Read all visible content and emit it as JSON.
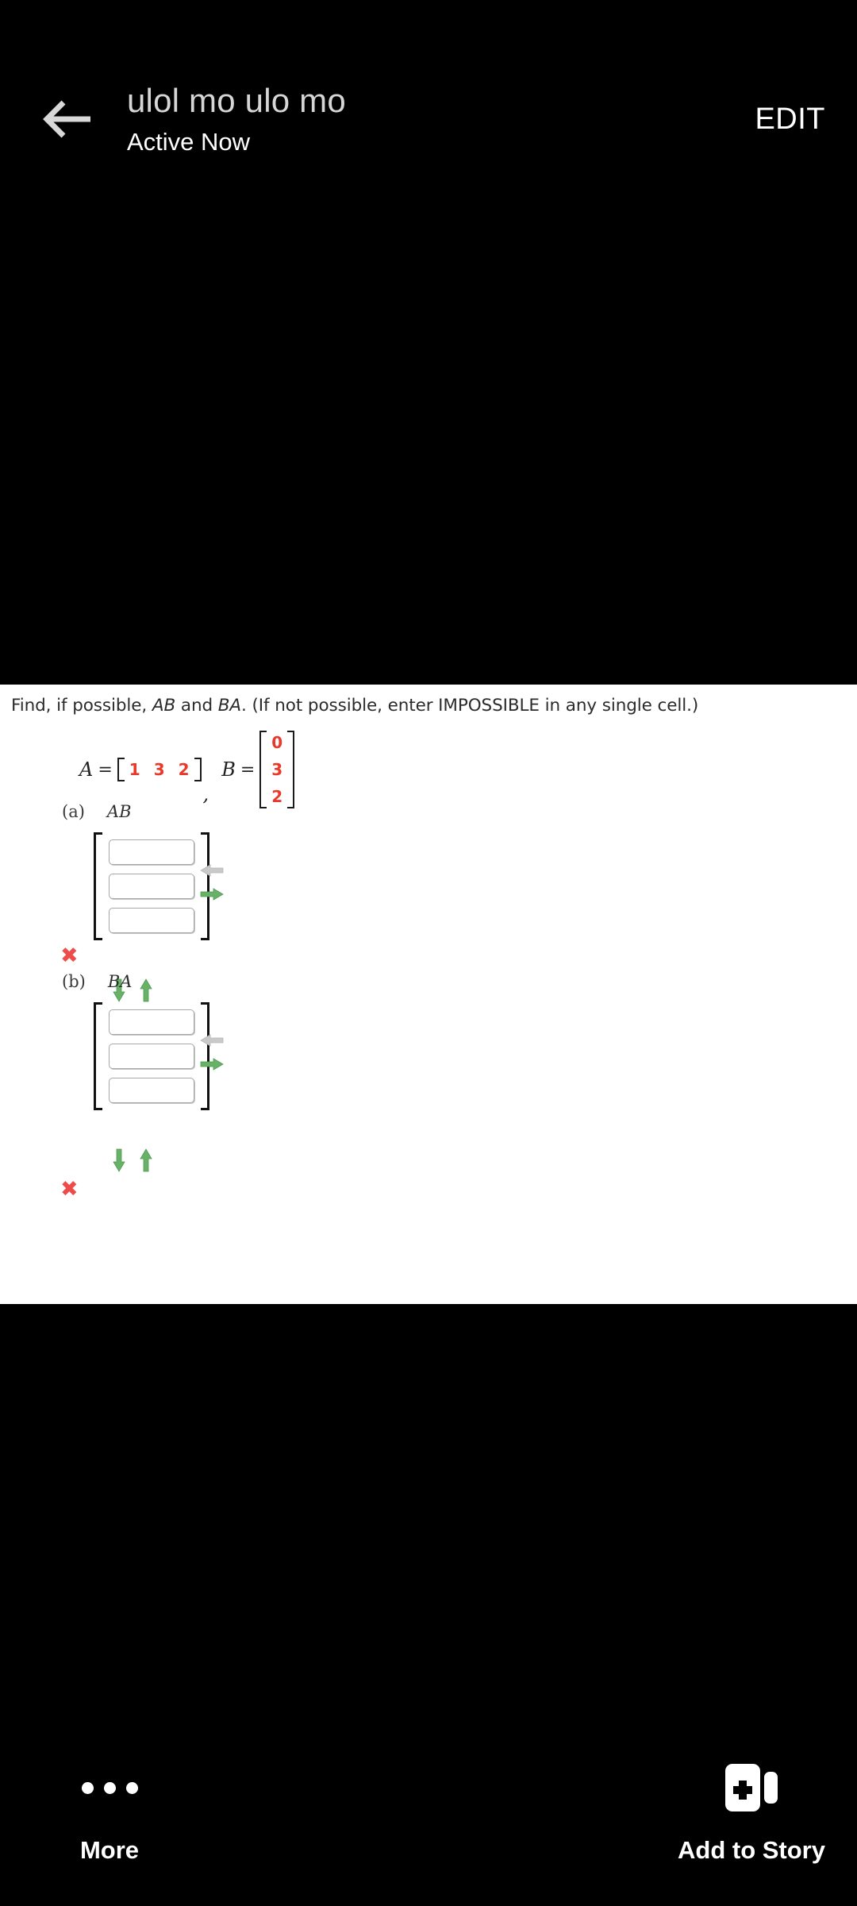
{
  "header": {
    "back_icon": "arrow-left-icon",
    "title": "ulol mo ulo mo",
    "status": "Active Now",
    "edit_label": "EDIT",
    "title_color": "#d6d6d6",
    "background": "#000000"
  },
  "media": {
    "background": "#ffffff",
    "question": {
      "prefix": "Find, if possible, ",
      "expr1": "AB",
      "mid": " and ",
      "expr2": "BA",
      "suffix": ". (If not possible, enter IMPOSSIBLE in any single cell.)"
    },
    "given": {
      "matrix_a": {
        "label": "A",
        "equals": "=",
        "rows": [
          [
            "1",
            "3",
            "2"
          ]
        ],
        "value_color": "#e8392b"
      },
      "separator": ",",
      "matrix_b": {
        "label": "B",
        "equals": "=",
        "rows": [
          [
            "0"
          ],
          [
            "3"
          ],
          [
            "2"
          ]
        ],
        "value_color": "#e8392b"
      }
    },
    "parts": [
      {
        "id": "(a)",
        "expression": "AB",
        "has_mark_above": false,
        "mark": "",
        "cells": [
          "",
          "",
          ""
        ],
        "cell_placeholder": "",
        "side_arrows": [
          "arrow-left-disabled-icon",
          "arrow-right-green-icon"
        ],
        "bottom_arrows": [
          "arrow-down-green-icon",
          "arrow-up-green-icon"
        ]
      },
      {
        "id": "(b)",
        "expression": "BA",
        "has_mark_above": true,
        "mark": "✖",
        "cells": [
          "",
          "",
          ""
        ],
        "cell_placeholder": "",
        "side_arrows": [
          "arrow-left-disabled-icon",
          "arrow-right-green-icon"
        ],
        "bottom_arrows": [
          "arrow-down-green-icon",
          "arrow-up-green-icon"
        ]
      }
    ],
    "trailing_mark": "✖",
    "mark_color": "#ee4b4b"
  },
  "footer": {
    "background": "#000000",
    "more": {
      "icon": "ellipsis-icon",
      "label": "More"
    },
    "add_to_story": {
      "icon": "add-to-story-icon",
      "label": "Add to Story"
    }
  }
}
